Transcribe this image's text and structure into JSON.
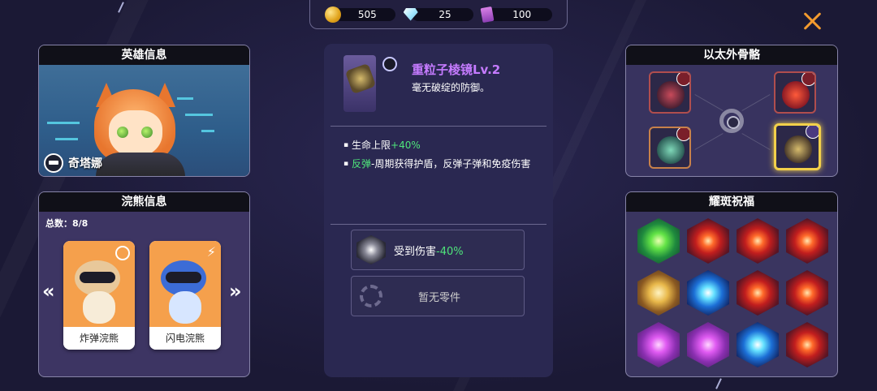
{
  "currency": {
    "coins": "505",
    "gems": "25",
    "tickets": "100"
  },
  "hero_panel": {
    "title": "英雄信息",
    "name": "奇塔娜"
  },
  "raccoon_panel": {
    "title": "浣熊信息",
    "total": "总数：8/8",
    "cards": [
      {
        "label": "炸弹浣熊"
      },
      {
        "label": "闪电浣熊"
      }
    ],
    "prev": "«",
    "next": "»"
  },
  "item_detail": {
    "title": "重粒子棱镜Lv.2",
    "desc": "毫无破绽的防御。",
    "stat1_label": "生命上限",
    "stat1_value": "+40%",
    "stat2_label": "反弹",
    "stat2_text": "-周期获得护盾，反弹子弹和免疫伤害",
    "part1_label": "受到伤害",
    "part1_value": "-40%",
    "part2_label": "暂无零件"
  },
  "ether_panel": {
    "title": "以太外骨骼"
  },
  "blessing_panel": {
    "title": "耀斑祝福"
  },
  "colors": {
    "accent_orange": "#f29a2e",
    "rarity_purple": "#c57bff",
    "positive_green": "#4fe57b"
  }
}
